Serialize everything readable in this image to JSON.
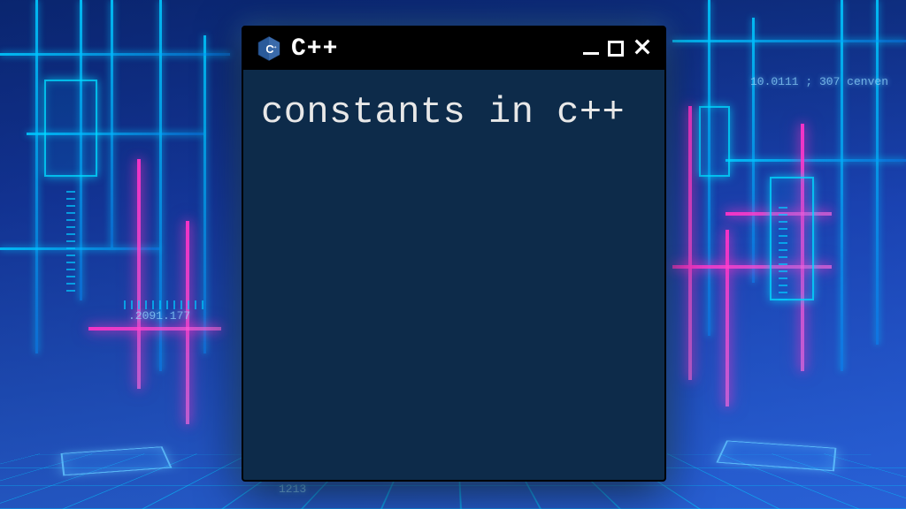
{
  "window": {
    "title": "C++",
    "body_text": "constants in c++"
  },
  "background": {
    "deco_text_1": "10.0111 ; 307  cenven",
    "deco_text_2": ".2091.177",
    "deco_text_3": "1213"
  },
  "colors": {
    "terminal_bg": "#0d2b4a",
    "titlebar_bg": "#000000",
    "neon_cyan": "#00c8ff",
    "neon_pink": "#ff32c8"
  }
}
